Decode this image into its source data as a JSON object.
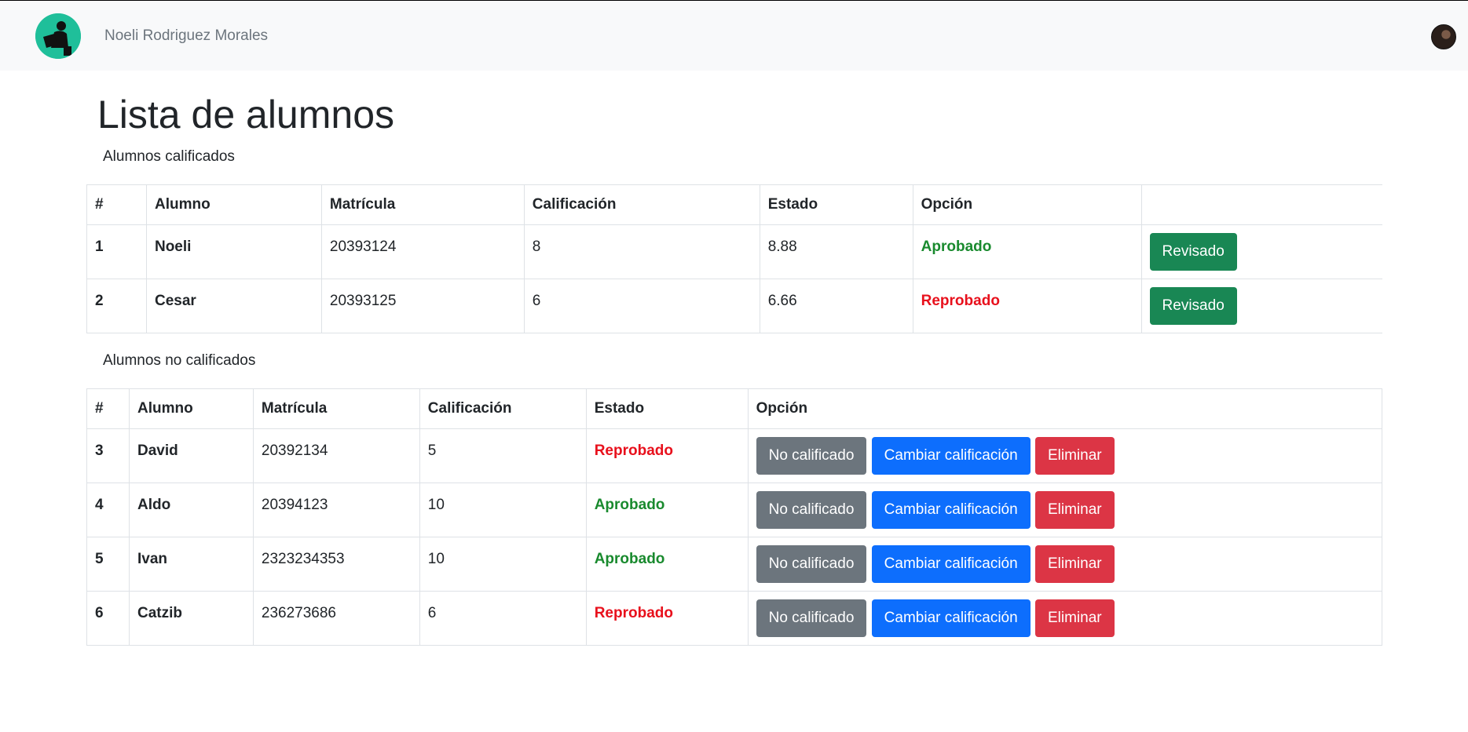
{
  "navbar": {
    "user_name": "Noeli Rodriguez Morales",
    "logo_icon": "reader-logo-icon",
    "avatar_icon": "user-avatar"
  },
  "page": {
    "title": "Lista de alumnos"
  },
  "graded": {
    "label": "Alumnos calificados",
    "headers": [
      "#",
      "Alumno",
      "Matrícula",
      "Calificación",
      "Estado",
      "Opción",
      ""
    ],
    "rows": [
      {
        "num": "1",
        "name": "Noeli",
        "id": "20393124",
        "grade": "8",
        "estado": "8.88",
        "opcion": "Aprobado",
        "status": "ok",
        "button": "Revisado"
      },
      {
        "num": "2",
        "name": "Cesar",
        "id": "20393125",
        "grade": "6",
        "estado": "6.66",
        "opcion": "Reprobado",
        "status": "bad",
        "button": "Revisado"
      }
    ]
  },
  "ungraded": {
    "label": "Alumnos no calificados",
    "headers": [
      "#",
      "Alumno",
      "Matrícula",
      "Calificación",
      "Estado",
      "Opción"
    ],
    "rows": [
      {
        "num": "3",
        "name": "David",
        "id": "20392134",
        "grade": "5",
        "estado": "Reprobado",
        "status": "bad"
      },
      {
        "num": "4",
        "name": "Aldo",
        "id": "20394123",
        "grade": "10",
        "estado": "Aprobado",
        "status": "ok"
      },
      {
        "num": "5",
        "name": "Ivan",
        "id": "2323234353",
        "grade": "10",
        "estado": "Aprobado",
        "status": "ok"
      },
      {
        "num": "6",
        "name": "Catzib",
        "id": "236273686",
        "grade": "6",
        "estado": "Reprobado",
        "status": "bad"
      }
    ],
    "buttons": {
      "not_graded": "No calificado",
      "change_grade": "Cambiar calificación",
      "delete": "Eliminar"
    }
  },
  "colors": {
    "approved": "#198a2e",
    "failed": "#e8101c",
    "success": "#198754",
    "secondary": "#6c757d",
    "primary": "#0d6efd",
    "danger": "#dc3545"
  }
}
